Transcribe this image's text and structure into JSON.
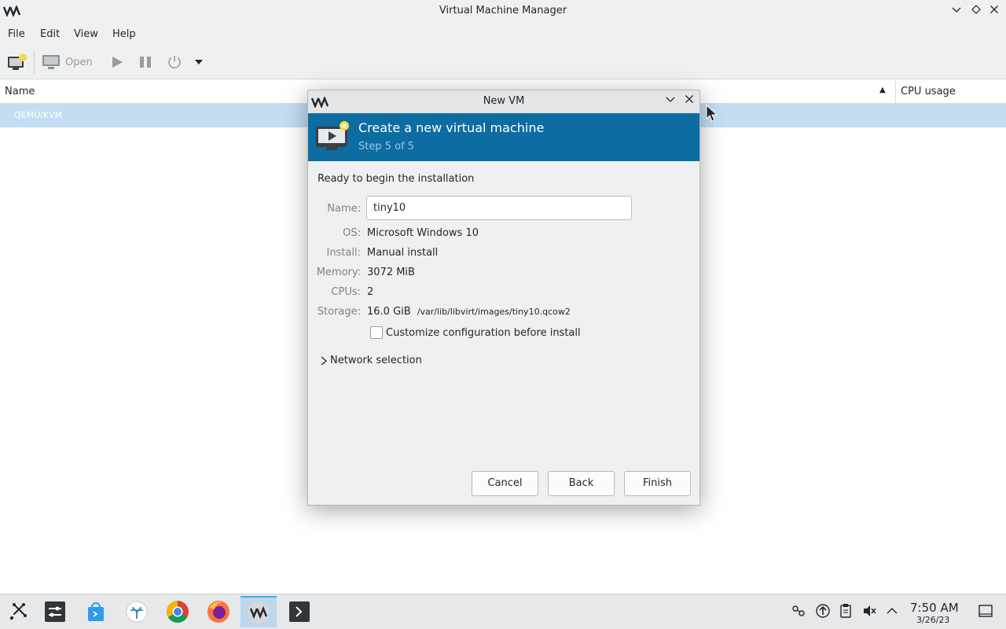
{
  "window": {
    "title": "Virtual Machine Manager",
    "logo": "VM"
  },
  "menu": [
    "File",
    "Edit",
    "View",
    "Help"
  ],
  "toolbar": {
    "open_label": "Open"
  },
  "list": {
    "col_name": "Name",
    "col_cpu": "CPU usage",
    "row_connection": "QEMU/KVM"
  },
  "dialog": {
    "title": "New VM",
    "banner_title": "Create a new virtual machine",
    "banner_step": "Step 5 of 5",
    "ready_text": "Ready to begin the installation",
    "fields": {
      "name_label": "Name:",
      "name_value": "tiny10",
      "os_label": "OS:",
      "os_value": "Microsoft Windows 10",
      "install_label": "Install:",
      "install_value": "Manual install",
      "memory_label": "Memory:",
      "memory_value": "3072 MiB",
      "cpus_label": "CPUs:",
      "cpus_value": "2",
      "storage_label": "Storage:",
      "storage_size": "16.0 GiB",
      "storage_path": "/var/lib/libvirt/images/tiny10.qcow2"
    },
    "customize_label": "Customize configuration before install",
    "customize_checked": false,
    "network_label": "Network selection",
    "buttons": {
      "cancel": "Cancel",
      "back": "Back",
      "finish": "Finish"
    }
  },
  "taskbar": {
    "clock_time": "7:50 AM",
    "clock_date": "3/26/23"
  },
  "colors": {
    "banner": "#0d6ca2",
    "selection_row": "#c3def2",
    "window_bg": "#eff0f1"
  }
}
